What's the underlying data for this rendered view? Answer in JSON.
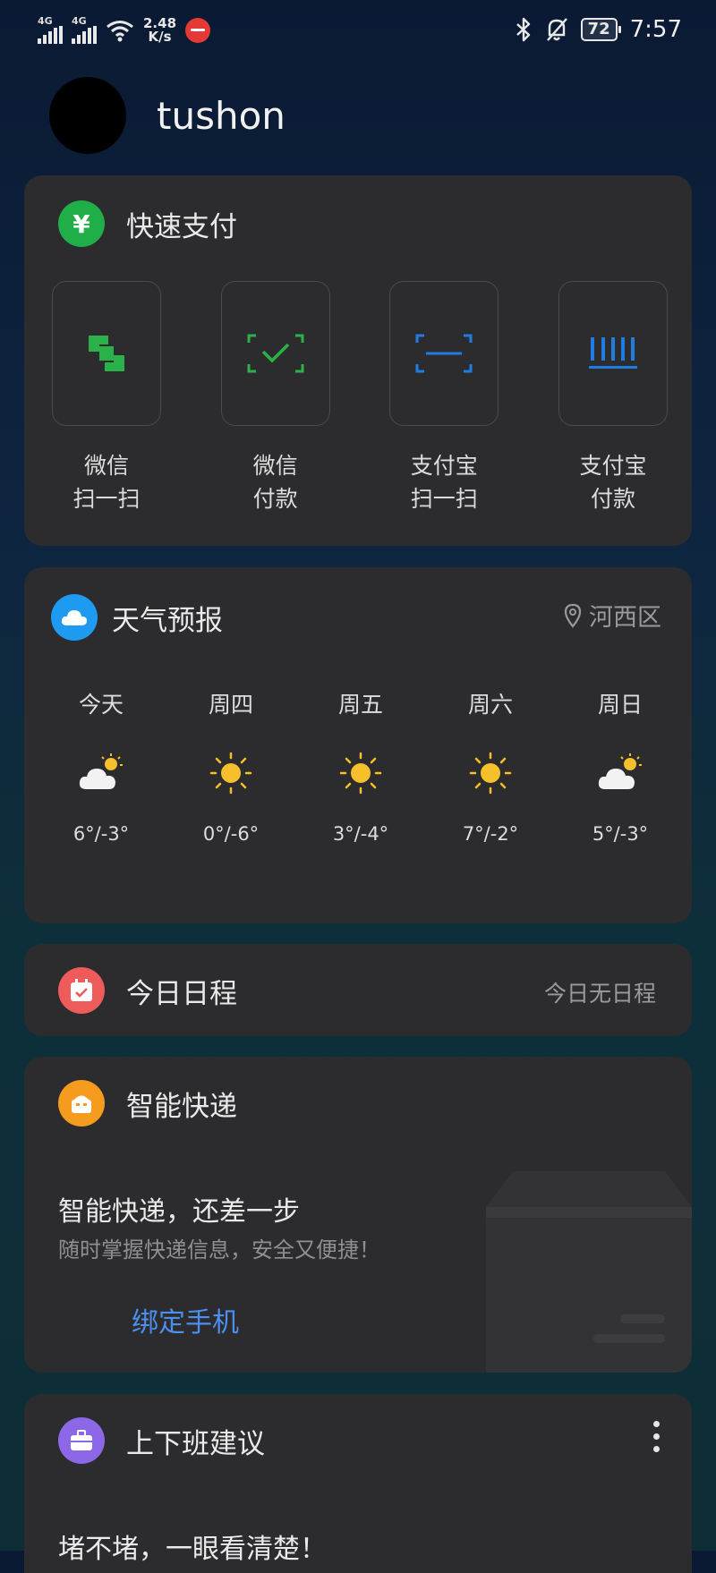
{
  "status": {
    "sig1_label": "4G",
    "sig2_label": "4G",
    "speed_value": "2.48",
    "speed_unit": "K/s",
    "battery": "72",
    "time": "7:57"
  },
  "profile": {
    "name": "tushon"
  },
  "quick_pay": {
    "title": "快速支付",
    "icon": "yuan-icon",
    "items": [
      {
        "line1": "微信",
        "line2": "扫一扫",
        "icon": "wechat-scan-icon",
        "color": "#2bb14a"
      },
      {
        "line1": "微信",
        "line2": "付款",
        "icon": "wechat-pay-icon",
        "color": "#2bb14a"
      },
      {
        "line1": "支付宝",
        "line2": "扫一扫",
        "icon": "alipay-scan-icon",
        "color": "#1f7ce0"
      },
      {
        "line1": "支付宝",
        "line2": "付款",
        "icon": "alipay-pay-icon",
        "color": "#1f7ce0"
      }
    ]
  },
  "weather": {
    "title": "天气预报",
    "location": "河西区",
    "days": [
      {
        "name": "今天",
        "temp": "6°/-3°",
        "icon": "partly-cloudy-icon"
      },
      {
        "name": "周四",
        "temp": "0°/-6°",
        "icon": "sunny-icon"
      },
      {
        "name": "周五",
        "temp": "3°/-4°",
        "icon": "sunny-icon"
      },
      {
        "name": "周六",
        "temp": "7°/-2°",
        "icon": "sunny-icon"
      },
      {
        "name": "周日",
        "temp": "5°/-3°",
        "icon": "partly-cloudy-icon"
      }
    ]
  },
  "schedule": {
    "title": "今日日程",
    "note": "今日无日程"
  },
  "express": {
    "title": "智能快递",
    "heading": "智能快递，还差一步",
    "subtitle": "随时掌握快递信息，安全又便捷！",
    "link": "绑定手机"
  },
  "commute": {
    "title": "上下班建议",
    "text": "堵不堵，一眼看清楚！"
  },
  "colors": {
    "green": "#1fae48",
    "blue": "#1e9af0",
    "red": "#ee5b5b",
    "orange": "#f59b1e",
    "purple": "#8c67e8",
    "link": "#4c8ff0",
    "card": "#2c2c2e"
  }
}
